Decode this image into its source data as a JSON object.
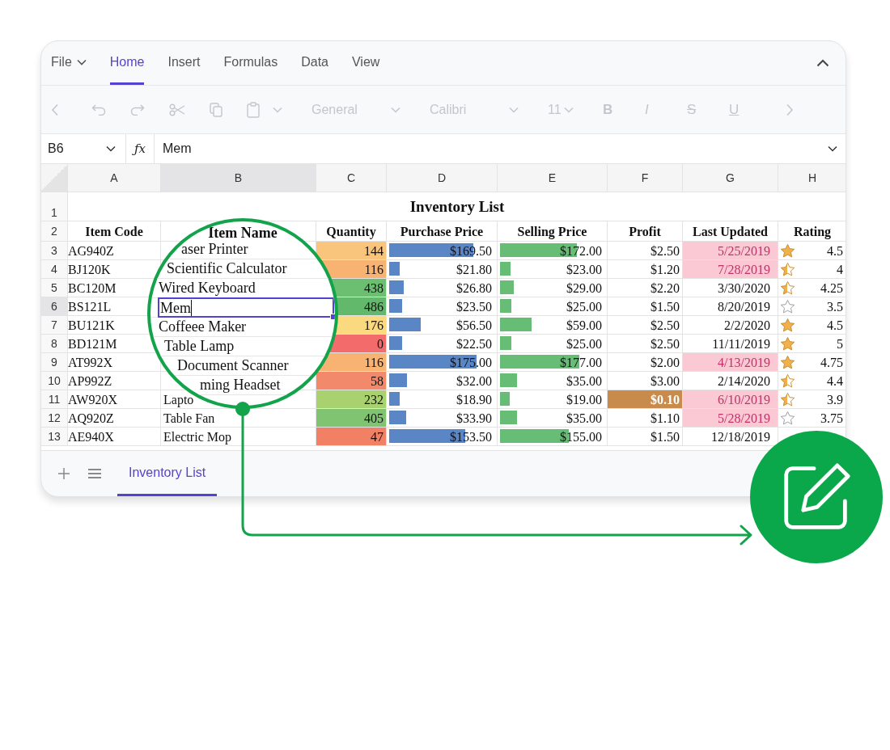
{
  "ribbon": {
    "tabs": [
      {
        "label": "File",
        "selected": false,
        "menu": true
      },
      {
        "label": "Home",
        "selected": true,
        "menu": false
      },
      {
        "label": "Insert",
        "selected": false,
        "menu": false
      },
      {
        "label": "Formulas",
        "selected": false,
        "menu": false
      },
      {
        "label": "Data",
        "selected": false,
        "menu": false
      },
      {
        "label": "View",
        "selected": false,
        "menu": false
      }
    ]
  },
  "toolbar": {
    "disabled": true,
    "number_format": "General",
    "font": "Calibri",
    "font_size": "11",
    "format_buttons": [
      "B",
      "I",
      "S",
      "U"
    ]
  },
  "formula_bar": {
    "cell": "B6",
    "function_label": "ƒx",
    "value": "Mem"
  },
  "sheet": {
    "columns": [
      {
        "label": "A",
        "selected": false
      },
      {
        "label": "B",
        "selected": true
      },
      {
        "label": "C",
        "selected": false
      },
      {
        "label": "D",
        "selected": false
      },
      {
        "label": "E",
        "selected": false
      },
      {
        "label": "F",
        "selected": false
      },
      {
        "label": "G",
        "selected": false
      },
      {
        "label": "H",
        "selected": false
      }
    ],
    "title_row": {
      "number": "1",
      "title": "Inventory List"
    },
    "header_row": {
      "number": "2",
      "headers": [
        "Item Code",
        "Quantity",
        "Purchase Price",
        "Selling Price",
        "Profit",
        "Last Updated",
        "Rating"
      ]
    },
    "rows": [
      {
        "number": "3",
        "selected": false,
        "code": "AG940Z",
        "quantity": "144",
        "color": "#f9c47c",
        "purchase": {
          "text": "$169.50",
          "level": 0.8
        },
        "selling": {
          "text": "$172.00",
          "level": 0.74
        },
        "profit": "$2.50",
        "profit_flagged": false,
        "last_updated": "5/25/2019",
        "date_flagged": true,
        "star": {
          "kind": "full"
        },
        "rating": "4.5"
      },
      {
        "number": "4",
        "selected": false,
        "code": "BJ120K",
        "quantity": "116",
        "color": "#f8b272",
        "purchase": {
          "text": "$21.80",
          "level": 0.1
        },
        "selling": {
          "text": "$23.00",
          "level": 0.1
        },
        "profit": "$1.20",
        "profit_flagged": false,
        "last_updated": "7/28/2019",
        "date_flagged": true,
        "star": {
          "kind": "partial"
        },
        "rating": "4"
      },
      {
        "number": "5",
        "selected": false,
        "code": "BC120M",
        "quantity": "438",
        "color": "#6cbf70",
        "purchase": {
          "text": "$26.80",
          "level": 0.14
        },
        "selling": {
          "text": "$29.00",
          "level": 0.13
        },
        "profit": "$2.20",
        "profit_flagged": false,
        "last_updated": "3/30/2020",
        "date_flagged": false,
        "star": {
          "kind": "partial"
        },
        "rating": "4.25"
      },
      {
        "number": "6",
        "selected": true,
        "code": "BS121L",
        "quantity": "486",
        "color": "#63b96b",
        "purchase": {
          "text": "$23.50",
          "level": 0.12
        },
        "selling": {
          "text": "$25.00",
          "level": 0.11
        },
        "profit": "$1.50",
        "profit_flagged": false,
        "last_updated": "8/20/2019",
        "date_flagged": false,
        "star": {
          "kind": "empty"
        },
        "rating": "3.5"
      },
      {
        "number": "7",
        "selected": false,
        "code": "BU121K",
        "quantity": "176",
        "color": "#fbd97f",
        "purchase": {
          "text": "$56.50",
          "level": 0.3
        },
        "selling": {
          "text": "$59.00",
          "level": 0.3
        },
        "profit": "$2.50",
        "profit_flagged": false,
        "last_updated": "2/2/2020",
        "date_flagged": false,
        "star": {
          "kind": "full"
        },
        "rating": "4.5"
      },
      {
        "number": "8",
        "selected": false,
        "code": "BD121M",
        "quantity": "0",
        "color": "#f46b6b",
        "purchase": {
          "text": "$22.50",
          "level": 0.12
        },
        "selling": {
          "text": "$25.00",
          "level": 0.11
        },
        "profit": "$2.50",
        "profit_flagged": false,
        "last_updated": "11/11/2019",
        "date_flagged": false,
        "star": {
          "kind": "full"
        },
        "rating": "5"
      },
      {
        "number": "9",
        "selected": false,
        "code": "AT992X",
        "quantity": "116",
        "color": "#f8b272",
        "purchase": {
          "text": "$175.00",
          "level": 0.83
        },
        "selling": {
          "text": "$177.00",
          "level": 0.76
        },
        "profit": "$2.00",
        "profit_flagged": false,
        "last_updated": "4/13/2019",
        "date_flagged": true,
        "star": {
          "kind": "full"
        },
        "rating": "4.75"
      },
      {
        "number": "10",
        "selected": false,
        "code": "AP992Z",
        "quantity": "58",
        "color": "#f3896b",
        "purchase": {
          "text": "$32.00",
          "level": 0.17
        },
        "selling": {
          "text": "$35.00",
          "level": 0.16
        },
        "profit": "$3.00",
        "profit_flagged": false,
        "last_updated": "2/14/2020",
        "date_flagged": false,
        "star": {
          "kind": "partial"
        },
        "rating": "4.4"
      },
      {
        "number": "11",
        "selected": false,
        "code": "AW920X",
        "name": "Lapto",
        "quantity": "232",
        "color": "#a9d170",
        "purchase": {
          "text": "$18.90",
          "level": 0.1
        },
        "selling": {
          "text": "$19.00",
          "level": 0.09
        },
        "profit": "$0.10",
        "profit_flagged": true,
        "last_updated": "6/10/2019",
        "date_flagged": true,
        "star": {
          "kind": "partial"
        },
        "rating": "3.9"
      },
      {
        "number": "12",
        "selected": false,
        "code": "AQ920Z",
        "name": "Table Fan",
        "quantity": "405",
        "color": "#80c472",
        "purchase": {
          "text": "$33.90",
          "level": 0.16
        },
        "selling": {
          "text": "$35.00",
          "level": 0.16
        },
        "profit": "$1.10",
        "profit_flagged": false,
        "last_updated": "5/28/2019",
        "date_flagged": true,
        "star": {
          "kind": "empty"
        },
        "rating": "3.75"
      },
      {
        "number": "13",
        "selected": false,
        "code": "AE940X",
        "name": "Electric Mop",
        "quantity": "47",
        "color": "#f28064",
        "purchase": {
          "text": "$153.50",
          "level": 0.72
        },
        "selling": {
          "text": "$155.00",
          "level": 0.66
        },
        "profit": "$1.50",
        "profit_flagged": false,
        "last_updated": "12/18/2019",
        "date_flagged": false
      }
    ]
  },
  "magnifier": {
    "header": "Item Name",
    "entries": [
      {
        "text": "aser Printer",
        "editing": false
      },
      {
        "text": "Scientific Calculator",
        "editing": false
      },
      {
        "text": "Wired Keyboard",
        "editing": false
      },
      {
        "text": "Mem",
        "editing": true
      },
      {
        "text": "Coffeee Maker",
        "editing": false
      },
      {
        "text": "Table Lamp",
        "editing": false
      },
      {
        "text": "Document Scanner",
        "editing": false
      },
      {
        "text": "ming Headset",
        "editing": false
      }
    ]
  },
  "sheet_tabs": [
    {
      "label": "Inventory List",
      "selected": true
    }
  ]
}
